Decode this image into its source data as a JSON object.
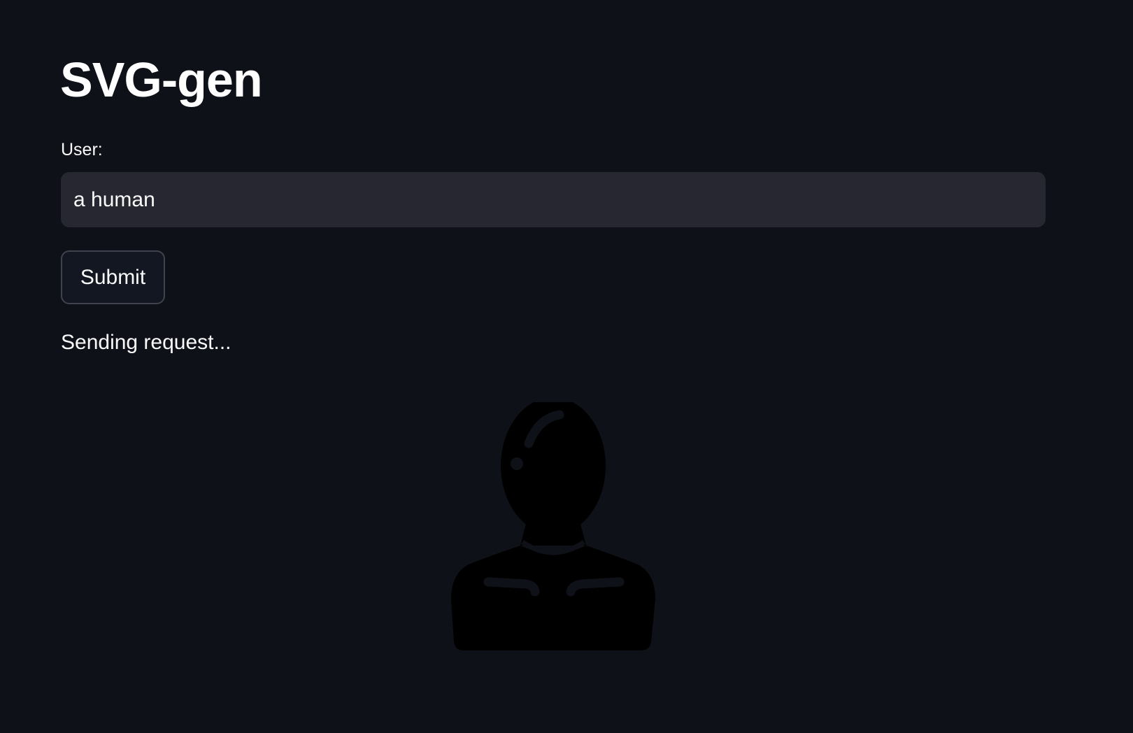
{
  "app": {
    "title": "SVG-gen"
  },
  "form": {
    "user_label": "User:",
    "user_value": "a human",
    "submit_label": "Submit"
  },
  "status": {
    "message": "Sending request..."
  },
  "result": {
    "icon": "person-silhouette-icon",
    "fill_color": "#000000"
  },
  "theme": {
    "background": "#0e1117",
    "input_background": "#262730",
    "text": "#fafafa"
  }
}
